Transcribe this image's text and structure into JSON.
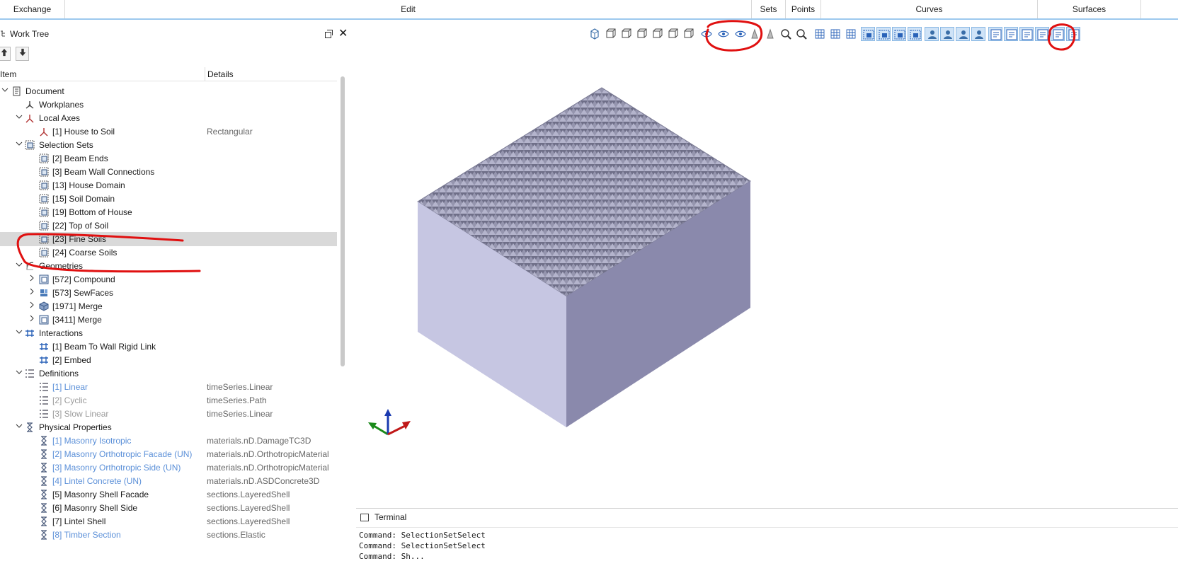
{
  "ribbon": {
    "groups": [
      {
        "label": "Exchange"
      },
      {
        "label": "Edit"
      },
      {
        "label": "Sets"
      },
      {
        "label": "Points"
      },
      {
        "label": "Curves"
      },
      {
        "label": "Surfaces"
      }
    ]
  },
  "panel": {
    "title": "Work Tree",
    "close_glyph": "✕",
    "up_glyph": "🡅",
    "down_glyph": "🡇",
    "col_item": "Item",
    "col_details": "Details"
  },
  "tree": [
    {
      "label": "Document",
      "details": "",
      "icon": "document-icon",
      "expander": "v",
      "style": "normal"
    },
    {
      "label": "Workplanes",
      "details": "",
      "icon": "workplane-icon",
      "expander": "",
      "style": "normal"
    },
    {
      "label": "Local Axes",
      "details": "",
      "icon": "axes-icon",
      "expander": "v",
      "style": "normal"
    },
    {
      "label": "[1] House to Soil",
      "details": "Rectangular",
      "icon": "axes-icon",
      "expander": "",
      "style": "normal"
    },
    {
      "label": "Selection Sets",
      "details": "",
      "icon": "selection-set-icon",
      "expander": "v",
      "style": "normal"
    },
    {
      "label": "[2] Beam Ends",
      "details": "",
      "icon": "selection-set-icon",
      "expander": "",
      "style": "normal"
    },
    {
      "label": "[3] Beam Wall Connections",
      "details": "",
      "icon": "selection-set-icon",
      "expander": "",
      "style": "normal"
    },
    {
      "label": "[13] House Domain",
      "details": "",
      "icon": "selection-set-icon",
      "expander": "",
      "style": "normal"
    },
    {
      "label": "[15] Soil Domain",
      "details": "",
      "icon": "selection-set-icon",
      "expander": "",
      "style": "normal"
    },
    {
      "label": "[19] Bottom of House",
      "details": "",
      "icon": "selection-set-icon",
      "expander": "",
      "style": "normal"
    },
    {
      "label": "[22] Top of Soil",
      "details": "",
      "icon": "selection-set-icon",
      "expander": "",
      "style": "normal"
    },
    {
      "label": "[23] Fine Soils",
      "details": "",
      "icon": "selection-set-icon",
      "expander": "",
      "style": "normal",
      "selected": true
    },
    {
      "label": "[24] Coarse Soils",
      "details": "",
      "icon": "selection-set-icon",
      "expander": "",
      "style": "normal"
    },
    {
      "label": "Geometries",
      "details": "",
      "icon": "geometry-icon",
      "expander": "v",
      "style": "normal"
    },
    {
      "label": "[572] Compound",
      "details": "",
      "icon": "compound-icon",
      "expander": ">",
      "style": "normal"
    },
    {
      "label": "[573] SewFaces",
      "details": "",
      "icon": "sewfaces-icon",
      "expander": ">",
      "style": "normal"
    },
    {
      "label": "[1971] Merge",
      "details": "",
      "icon": "solid-icon",
      "expander": ">",
      "style": "normal"
    },
    {
      "label": "[3411] Merge",
      "details": "",
      "icon": "compound-icon",
      "expander": ">",
      "style": "normal"
    },
    {
      "label": "Interactions",
      "details": "",
      "icon": "interaction-icon",
      "expander": "v",
      "style": "normal"
    },
    {
      "label": "[1] Beam To Wall Rigid Link",
      "details": "",
      "icon": "interaction-icon",
      "expander": "",
      "style": "normal"
    },
    {
      "label": "[2] Embed",
      "details": "",
      "icon": "interaction-icon",
      "expander": "",
      "style": "normal"
    },
    {
      "label": "Definitions",
      "details": "",
      "icon": "definition-icon",
      "expander": "v",
      "style": "normal"
    },
    {
      "label": "[1] Linear",
      "details": "timeSeries.Linear",
      "icon": "definition-icon",
      "expander": "",
      "style": "blue"
    },
    {
      "label": "[2] Cyclic",
      "details": "timeSeries.Path",
      "icon": "definition-icon",
      "expander": "",
      "style": "gray"
    },
    {
      "label": "[3] Slow Linear",
      "details": "timeSeries.Linear",
      "icon": "definition-icon",
      "expander": "",
      "style": "gray"
    },
    {
      "label": "Physical Properties",
      "details": "",
      "icon": "property-icon",
      "expander": "v",
      "style": "normal"
    },
    {
      "label": "[1] Masonry Isotropic",
      "details": "materials.nD.DamageTC3D",
      "icon": "property-icon",
      "expander": "",
      "style": "blue"
    },
    {
      "label": "[2] Masonry Orthotropic Facade (UN)",
      "details": "materials.nD.OrthotropicMaterial",
      "icon": "property-icon",
      "expander": "",
      "style": "blue"
    },
    {
      "label": "[3] Masonry Orthotropic Side (UN)",
      "details": "materials.nD.OrthotropicMaterial",
      "icon": "property-icon",
      "expander": "",
      "style": "blue"
    },
    {
      "label": "[4] Lintel Concrete (UN)",
      "details": "materials.nD.ASDConcrete3D",
      "icon": "property-icon",
      "expander": "",
      "style": "blue"
    },
    {
      "label": "[5] Masonry Shell Facade",
      "details": "sections.LayeredShell",
      "icon": "property-icon",
      "expander": "",
      "style": "normal"
    },
    {
      "label": "[6] Masonry Shell Side",
      "details": "sections.LayeredShell",
      "icon": "property-icon",
      "expander": "",
      "style": "normal"
    },
    {
      "label": "[7] Lintel Shell",
      "details": "sections.LayeredShell",
      "icon": "property-icon",
      "expander": "",
      "style": "normal"
    },
    {
      "label": "[8] Timber Section",
      "details": "sections.Elastic",
      "icon": "property-icon",
      "expander": "",
      "style": "blue"
    }
  ],
  "toolbar": {
    "buttons": [
      "iso-view-icon",
      "front-view-icon",
      "back-view-icon",
      "left-view-icon",
      "right-view-icon",
      "top-view-icon",
      "bottom-view-icon",
      "show-selection-icon",
      "show-icon",
      "hide-icon",
      "clipping-icon",
      "bars-icon",
      "zoom-fit-icon",
      "zoom-icon",
      "screen-icon",
      "brush-icon",
      "grid-icon",
      "select-icon",
      "select-edge-icon",
      "select-face-icon",
      "select-solid-icon",
      "view-a-icon",
      "view-b-icon",
      "view-c-icon",
      "view-d-icon",
      "filter-a-icon",
      "filter-b-icon",
      "filter-c-icon",
      "filter-d-icon",
      "filter-e-icon",
      "filter-f-icon"
    ],
    "highlighted": [
      17,
      18,
      19,
      20,
      21,
      22,
      23,
      24,
      25,
      26,
      27,
      28,
      29,
      30
    ]
  },
  "terminal": {
    "title": "Terminal",
    "lines": [
      "Command: SelectionSetSelect",
      "Command: SelectionSetSelect",
      "Command: Sh..."
    ]
  },
  "colors": {
    "accent": "#9dc9ee",
    "box_top": "#8b8ca8",
    "box_left": "#c6c6e2",
    "box_right": "#8a89ac",
    "annotation": "#e01010"
  }
}
